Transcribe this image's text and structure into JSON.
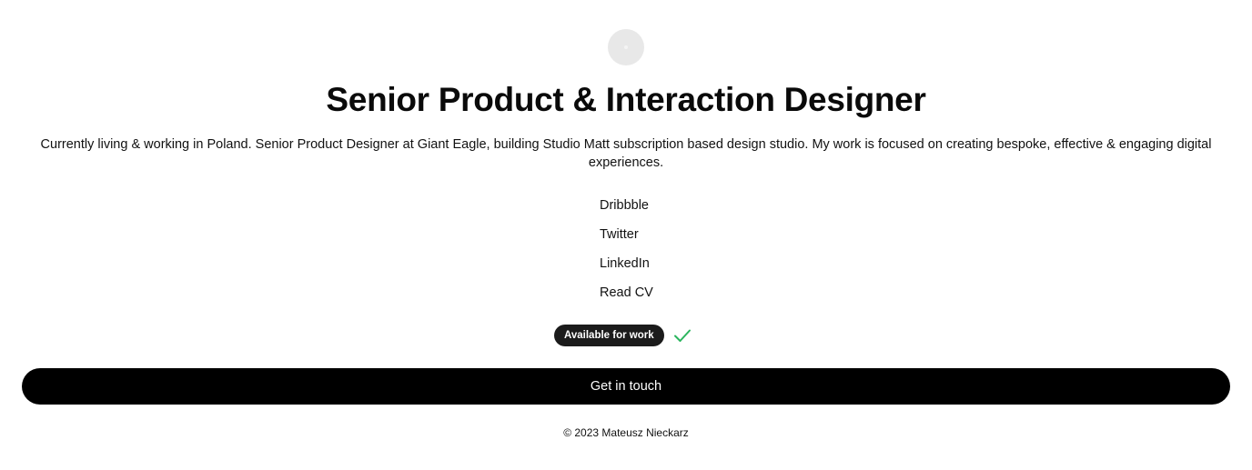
{
  "profile": {
    "title": "Senior Product & Interaction Designer",
    "bio": "Currently living & working in Poland. Senior Product Designer at Giant Eagle, building Studio Matt subscription based design studio. My work is focused on creating bespoke, effective & engaging digital experiences."
  },
  "links": [
    {
      "label": "Dribbble"
    },
    {
      "label": "Twitter"
    },
    {
      "label": "LinkedIn"
    },
    {
      "label": "Read CV"
    }
  ],
  "status": {
    "badge": "Available for work",
    "icon": "checkmark-icon",
    "color": "#2bb55e"
  },
  "cta": {
    "label": "Get in touch"
  },
  "footer": {
    "copyright": "© 2023 Mateusz Nieckarz"
  },
  "colors": {
    "background": "#ffffff",
    "text": "#111111",
    "button": "#000000",
    "badge": "#1b1b1b",
    "avatar": "#e8e8e8"
  }
}
